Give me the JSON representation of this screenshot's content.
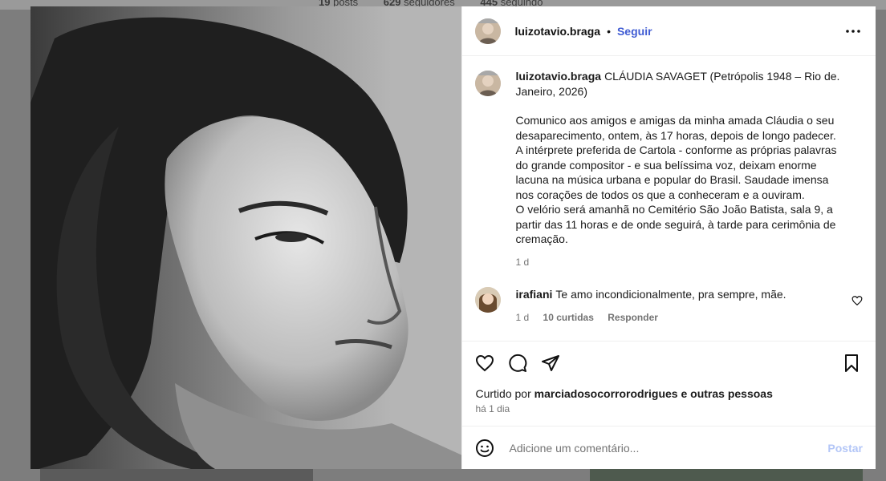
{
  "background": {
    "stats": {
      "posts_count": "19",
      "posts_label": "posts",
      "followers_count": "629",
      "followers_label": "seguidores",
      "following_count": "445",
      "following_label": "seguindo"
    }
  },
  "post": {
    "username": "luizotavio.braga",
    "separator": "•",
    "follow_label": "Seguir",
    "more_icon": "more-horizontal-icon",
    "caption": {
      "username": "luizotavio.braga",
      "title": "CLÁUDIA SAVAGET (Petrópolis 1948 – Rio de. Janeiro, 2026)",
      "lines": [
        "Comunico aos amigos e amigas da minha amada Cláudia o seu",
        "desaparecimento, ontem, às 17 horas, depois de longo padecer.",
        "A intérprete preferida de Cartola - conforme as próprias palavras",
        "do grande compositor - e sua belíssima voz, deixam enorme",
        "lacuna na música urbana e popular do Brasil. Saudade imensa",
        "nos corações de todos os que a conheceram e a ouviram.",
        "O velório será amanhã no Cemitério São João Batista, sala 9, a",
        "partir das 11 horas e de onde seguirá, à tarde para cerimônia de",
        "cremação."
      ],
      "time": "1 d"
    },
    "comments": [
      {
        "username": "irafiani",
        "text": "Te amo incondicionalmente, pra sempre, mãe.",
        "time": "1 d",
        "likes": "10 curtidas",
        "reply_label": "Responder"
      }
    ],
    "actions": {
      "like_icon": "heart-icon",
      "comment_icon": "comment-icon",
      "share_icon": "share-icon",
      "save_icon": "bookmark-icon"
    },
    "liked_by_prefix": "Curtido por",
    "liked_by_user": "marciadosocorrorodrigues",
    "liked_by_suffix": "e outras pessoas",
    "posted_ago": "há 1 dia",
    "add_comment": {
      "placeholder": "Adicione um comentário...",
      "post_label": "Postar",
      "post_color": "#b3c6f7"
    }
  },
  "colors": {
    "accent": "#3f5bd3",
    "muted": "#737373",
    "divider": "#efefef"
  }
}
